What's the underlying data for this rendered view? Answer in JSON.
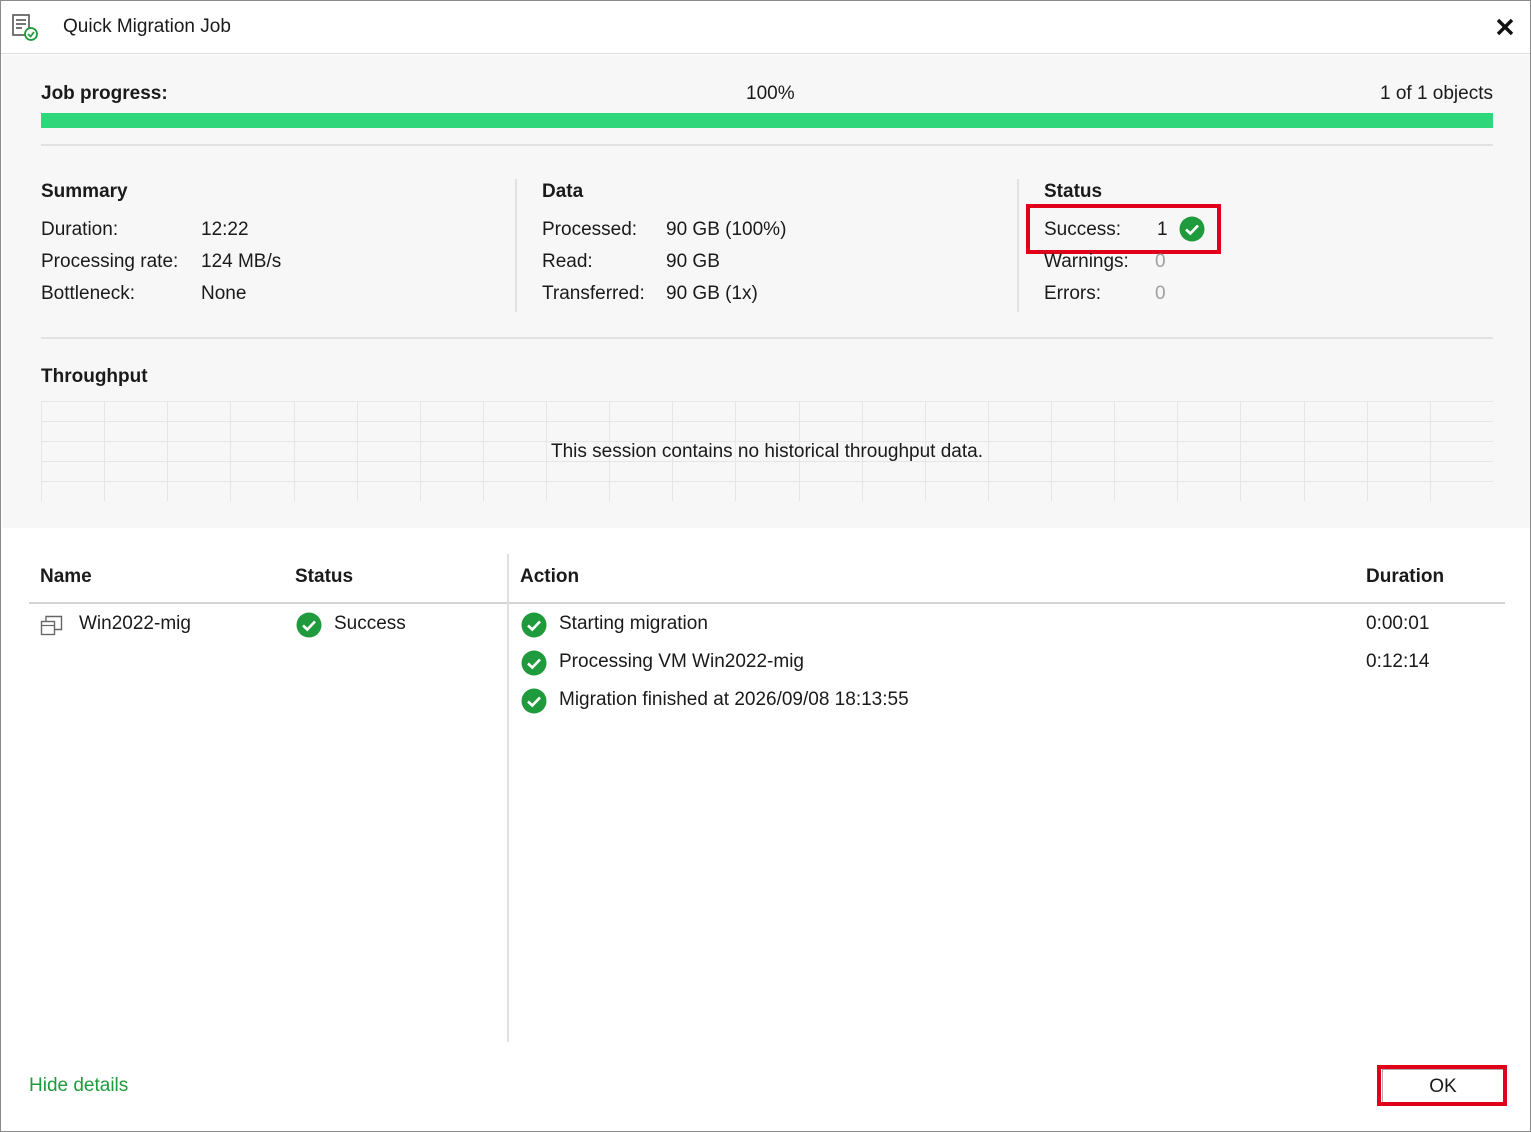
{
  "window": {
    "title": "Quick Migration Job"
  },
  "progress": {
    "label": "Job progress:",
    "percent_text": "100%",
    "percent": 100,
    "objects_text": "1 of 1 objects"
  },
  "summary": {
    "heading": "Summary",
    "rows": [
      {
        "label": "Duration:",
        "value": "12:22"
      },
      {
        "label": "Processing rate:",
        "value": "124 MB/s"
      },
      {
        "label": "Bottleneck:",
        "value": "None"
      }
    ]
  },
  "data": {
    "heading": "Data",
    "rows": [
      {
        "label": "Processed:",
        "value": "90 GB (100%)"
      },
      {
        "label": "Read:",
        "value": "90 GB"
      },
      {
        "label": "Transferred:",
        "value": "90 GB (1x)"
      }
    ]
  },
  "status": {
    "heading": "Status",
    "rows": [
      {
        "label": "Success:",
        "value": "1"
      },
      {
        "label": "Warnings:",
        "value": "0"
      },
      {
        "label": "Errors:",
        "value": "0"
      }
    ]
  },
  "throughput": {
    "heading": "Throughput",
    "empty_message": "This session contains no historical throughput data."
  },
  "table": {
    "headers": {
      "name": "Name",
      "status": "Status",
      "action": "Action",
      "duration": "Duration"
    },
    "objects": [
      {
        "name": "Win2022-mig",
        "status": "Success"
      }
    ],
    "actions": [
      {
        "text": "Starting migration",
        "duration": "0:00:01"
      },
      {
        "text": "Processing VM Win2022-mig",
        "duration": "0:12:14"
      },
      {
        "text": "Migration finished at 2026/09/08 18:13:55",
        "duration": ""
      }
    ]
  },
  "footer": {
    "hide_details_label": "Hide details",
    "ok_label": "OK"
  },
  "colors": {
    "progress_fill": "#30d67a",
    "success_icon": "#1f9a3c",
    "highlight": "#e0001a",
    "link": "#1f9a3c"
  },
  "icons": {
    "title": "job-report-icon",
    "close": "close-icon",
    "success": "check-circle-icon",
    "vm": "vm-icon"
  }
}
